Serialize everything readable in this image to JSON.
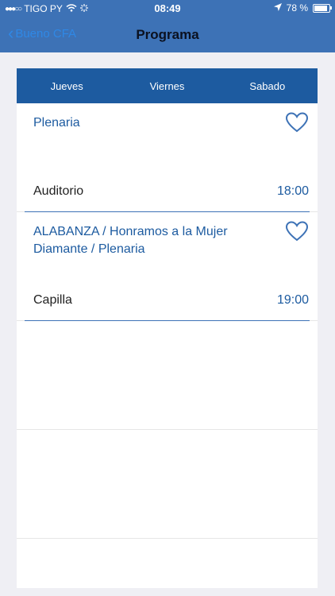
{
  "statusbar": {
    "carrier": "TIGO PY",
    "time": "08:49",
    "battery": "78 %",
    "battery_level": 0.78
  },
  "navbar": {
    "back_label": "Bueno CFA",
    "title": "Programa"
  },
  "tabs": [
    {
      "label": "Jueves"
    },
    {
      "label": "Viernes"
    },
    {
      "label": "Sabado"
    }
  ],
  "events": [
    {
      "title": "Plenaria",
      "place": "Auditorio",
      "time": "18:00"
    },
    {
      "title": "ALABANZA / Honramos a la Mujer Diamante / Plenaria",
      "place": "Capilla",
      "time": "19:00"
    }
  ],
  "colors": {
    "bar": "#3d72b6",
    "tabs": "#1d5ba0",
    "accent": "#1d5ba0",
    "background": "#efeff4"
  }
}
